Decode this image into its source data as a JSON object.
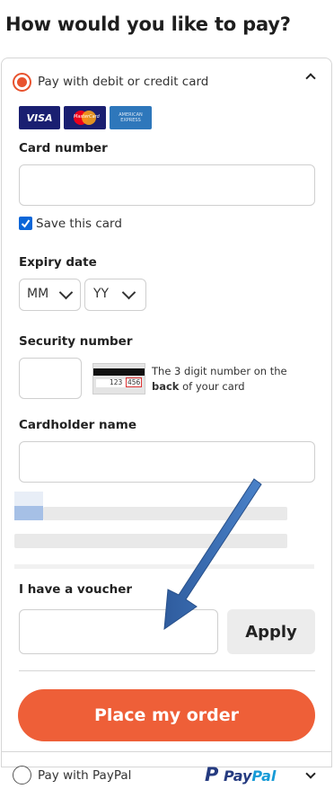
{
  "page": {
    "title": "How would you like to pay?"
  },
  "card_option": {
    "label": "Pay with debit or credit card",
    "selected": true,
    "logos": [
      {
        "name": "VISA",
        "color": "#1a1f71"
      },
      {
        "name": "MasterCard",
        "color": "#1a1f71"
      },
      {
        "name": "AMERICAN EXPRESS",
        "color": "#2e77bb"
      }
    ]
  },
  "card_number": {
    "label": "Card number",
    "value": "",
    "placeholder": ""
  },
  "save_card": {
    "label": "Save this card",
    "checked": true
  },
  "expiry": {
    "label": "Expiry date",
    "month": "MM",
    "year": "YY"
  },
  "security": {
    "label": "Security number",
    "value": "",
    "card_digits_left": "123",
    "card_digits_right": "456",
    "hint_line1": "The 3 digit number on the",
    "hint_bold": "back",
    "hint_rest": " of your card"
  },
  "cardholder": {
    "label": "Cardholder name",
    "value": ""
  },
  "voucher": {
    "label": "I have a voucher",
    "value": "",
    "apply_label": "Apply"
  },
  "place_order": {
    "label": "Place my order"
  },
  "paypal_option": {
    "label": "Pay with PayPal",
    "logo_p": "P",
    "logo_pay": "Pay",
    "logo_pal": "Pal",
    "selected": false
  },
  "colors": {
    "accent": "#ee5f38",
    "paypal_dark": "#253b80",
    "paypal_light": "#179bd7",
    "arrow": "#3a6fb6"
  }
}
